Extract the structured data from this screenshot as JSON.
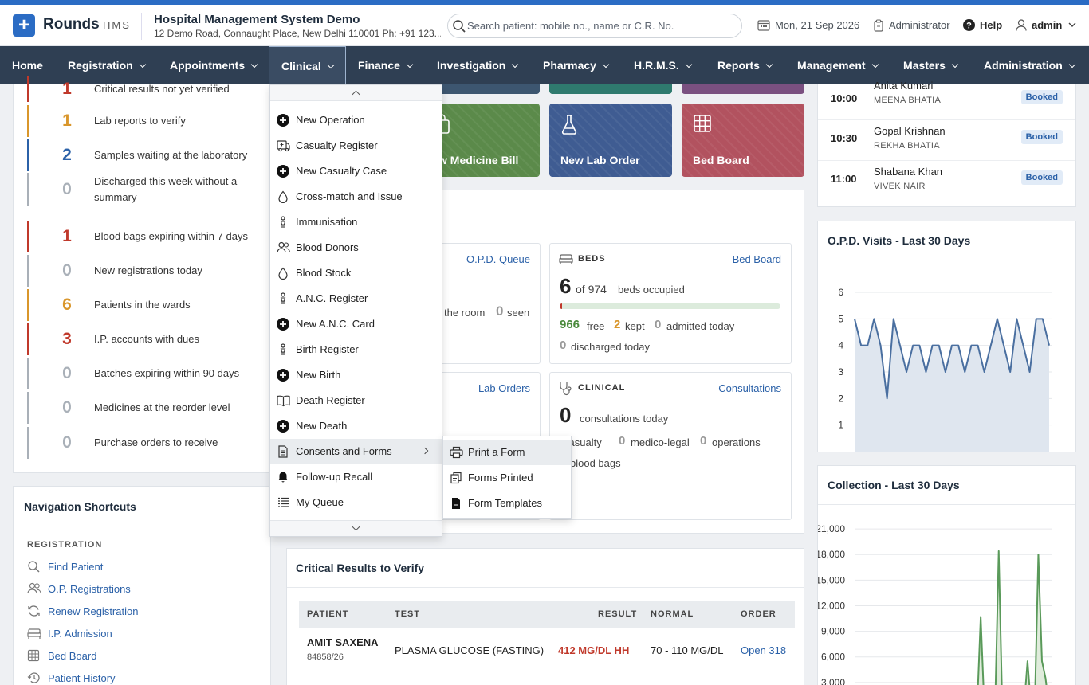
{
  "header": {
    "brand": "Rounds",
    "brand_sub": "HMS",
    "hospital_name": "Hospital Management System Demo",
    "hospital_address": "12 Demo Road, Connaught Place, New Delhi 110001 Ph: +91 123...",
    "search_placeholder": "Search patient: mobile no., name or C.R. No.",
    "date": "Mon, 21 Sep 2026",
    "role": "Administrator",
    "help": "Help",
    "user": "admin"
  },
  "nav": [
    "Home",
    "Registration",
    "Appointments",
    "Clinical",
    "Finance",
    "Investigation",
    "Pharmacy",
    "H.R.M.S.",
    "Reports",
    "Management",
    "Masters",
    "Administration"
  ],
  "alerts": [
    {
      "count": "1",
      "text": "Critical results not yet verified",
      "color": "#c0392b"
    },
    {
      "count": "1",
      "text": "Lab reports to verify",
      "color": "#d9962b"
    },
    {
      "count": "2",
      "text": "Samples waiting at the laboratory",
      "color": "#2b61a8"
    },
    {
      "count": "0",
      "text": "Discharged this week without a summary",
      "color": "#a9b0b8"
    },
    {
      "count": "1",
      "text": "Blood bags expiring within 7 days",
      "color": "#c0392b"
    },
    {
      "count": "0",
      "text": "New registrations today",
      "color": "#a9b0b8"
    },
    {
      "count": "6",
      "text": "Patients in the wards",
      "color": "#d9962b"
    },
    {
      "count": "3",
      "text": "I.P. accounts with dues",
      "color": "#c0392b"
    },
    {
      "count": "0",
      "text": "Batches expiring within 90 days",
      "color": "#a9b0b8"
    },
    {
      "count": "0",
      "text": "Medicines at the reorder level",
      "color": "#a9b0b8"
    },
    {
      "count": "0",
      "text": "Purchase orders to receive",
      "color": "#a9b0b8"
    }
  ],
  "shortcuts": {
    "title": "Navigation Shortcuts",
    "section": "REGISTRATION",
    "links": [
      "Find Patient",
      "O.P. Registrations",
      "Renew Registration",
      "I.P. Admission",
      "Bed Board",
      "Patient History"
    ]
  },
  "tiles": [
    "w Medicine Bill",
    "New Lab Order",
    "Bed Board"
  ],
  "opd_card": {
    "link": "O.P.D. Queue",
    "in_room_text": "the room",
    "seen_count": "0",
    "seen_label": "seen"
  },
  "lab_card": {
    "link": "Lab Orders"
  },
  "beds_card": {
    "title": "BEDS",
    "link": "Bed Board",
    "occupied": "6",
    "of_total": "of 974",
    "occupied_label": "beds occupied",
    "occupancy_fraction": 0.006,
    "free": "966",
    "free_label": "free",
    "kept": "2",
    "kept_label": "kept",
    "admitted": "0",
    "admitted_label": "admitted today",
    "discharged": "0",
    "discharged_label": "discharged today"
  },
  "clinical_card": {
    "title": "CLINICAL",
    "link": "Consultations",
    "consultations": "0",
    "consultations_label": "consultations today",
    "casualty_label": "casualty",
    "medico_legal": "0",
    "medico_legal_label": "medico-legal",
    "operations": "0",
    "operations_label": "operations",
    "blood_label": "blood bags"
  },
  "critical": {
    "title": "Critical Results to Verify",
    "headers": [
      "PATIENT",
      "TEST",
      "RESULT",
      "NORMAL",
      "ORDER"
    ],
    "row": {
      "patient": "AMIT SAXENA",
      "patient_id": "84858/26",
      "test": "PLASMA GLUCOSE (FASTING)",
      "result": "412 MG/DL HH",
      "normal": "70 - 110 MG/DL",
      "order": "Open 318"
    }
  },
  "appointments": [
    {
      "time": "10:00",
      "patient": "Anita Kumari",
      "doctor": "MEENA BHATIA",
      "status": "Booked"
    },
    {
      "time": "10:30",
      "patient": "Gopal Krishnan",
      "doctor": "REKHA BHATIA",
      "status": "Booked"
    },
    {
      "time": "11:00",
      "patient": "Shabana Khan",
      "doctor": "VIVEK NAIR",
      "status": "Booked"
    }
  ],
  "clinical_menu": {
    "items": [
      {
        "label": "New Operation",
        "icon": "plus-circle-icon"
      },
      {
        "label": "Casualty Register",
        "icon": "ambulance-icon"
      },
      {
        "label": "New Casualty Case",
        "icon": "plus-circle-icon"
      },
      {
        "label": "Cross-match and Issue",
        "icon": "drop-icon"
      },
      {
        "label": "Immunisation",
        "icon": "person-icon"
      },
      {
        "label": "Blood Donors",
        "icon": "people-icon"
      },
      {
        "label": "Blood Stock",
        "icon": "drop-icon"
      },
      {
        "label": "A.N.C. Register",
        "icon": "person-icon"
      },
      {
        "label": "New A.N.C. Card",
        "icon": "plus-circle-icon"
      },
      {
        "label": "Birth Register",
        "icon": "person-icon"
      },
      {
        "label": "New Birth",
        "icon": "plus-circle-icon"
      },
      {
        "label": "Death Register",
        "icon": "book-icon"
      },
      {
        "label": "New Death",
        "icon": "plus-circle-icon"
      },
      {
        "label": "Consents and Forms",
        "icon": "document-icon"
      },
      {
        "label": "Follow-up Recall",
        "icon": "bell-icon"
      },
      {
        "label": "My Queue",
        "icon": "list-icon"
      }
    ],
    "submenu": [
      {
        "label": "Print a Form",
        "icon": "printer-icon"
      },
      {
        "label": "Forms Printed",
        "icon": "copy-icon"
      },
      {
        "label": "Form Templates",
        "icon": "file-icon"
      }
    ]
  },
  "chart_data": [
    {
      "type": "area",
      "title": "O.P.D. Visits - Last 30 Days",
      "y_ticks": [
        "1",
        "2",
        "3",
        "4",
        "5",
        "6"
      ],
      "ylim": [
        0.6,
        6.3
      ],
      "x": [
        1,
        2,
        3,
        4,
        5,
        6,
        7,
        8,
        9,
        10,
        11,
        12,
        13,
        14,
        15,
        16,
        17,
        18,
        19,
        20,
        21,
        22,
        23,
        24,
        25,
        26,
        27,
        28,
        29,
        30
      ],
      "values": [
        5,
        4,
        4,
        5,
        4,
        2,
        5,
        4,
        3,
        4,
        4,
        3,
        4,
        4,
        3,
        4,
        4,
        3,
        4,
        4,
        3,
        4,
        5,
        4,
        3,
        5,
        4,
        3,
        5,
        5,
        4
      ],
      "grid": true,
      "color": "#4a6fa0"
    },
    {
      "type": "area",
      "title": "Collection - Last 30 Days",
      "y_ticks": [
        "3,000",
        "6,000",
        "9,000",
        "12,000",
        "15,000",
        "18,000",
        "21,000"
      ],
      "ylim": [
        0,
        22500
      ],
      "values": [
        0,
        0,
        0,
        0,
        0,
        0,
        0,
        0,
        0,
        0,
        0,
        0,
        0,
        0,
        0,
        0,
        0,
        0,
        0,
        0,
        0,
        0,
        0,
        0,
        0,
        0,
        0,
        0,
        0,
        0,
        0,
        0,
        0,
        0,
        0,
        10700,
        0,
        0,
        0,
        0,
        18400,
        0,
        0,
        0,
        0,
        0,
        0,
        0,
        5500,
        0,
        0,
        18000,
        5500,
        3500,
        0
      ],
      "grid": true,
      "color": "#5a9a5a"
    }
  ]
}
